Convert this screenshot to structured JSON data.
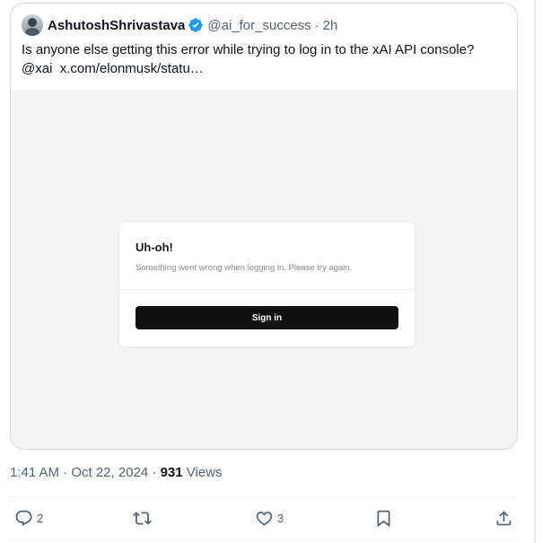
{
  "quote": {
    "author_name": "AshutoshShrivastava",
    "handle": "@ai_for_success",
    "separator": "·",
    "time_ago": "2h",
    "text_line1": "Is anyone else getting this error while trying to log in to the xAI API console?",
    "mention": "@xai",
    "link_text": "x.com/elonmusk/statu…"
  },
  "screenshot_card": {
    "title": "Uh-oh!",
    "message": "Something went wrong when logging in. Please try again.",
    "button_label": "Sign in"
  },
  "meta": {
    "timestamp": "1:41 AM · Oct 22, 2024 ·",
    "views_count": "931",
    "views_label": "Views"
  },
  "actions": {
    "reply_count": "2",
    "like_count": "3"
  },
  "colors": {
    "verified": "#1d9bf0",
    "secondary_text": "#536471",
    "border": "#cfd9de"
  },
  "icons": [
    "avatar",
    "verified-badge-icon",
    "reply-icon",
    "retweet-icon",
    "like-icon",
    "bookmark-icon",
    "share-icon"
  ]
}
